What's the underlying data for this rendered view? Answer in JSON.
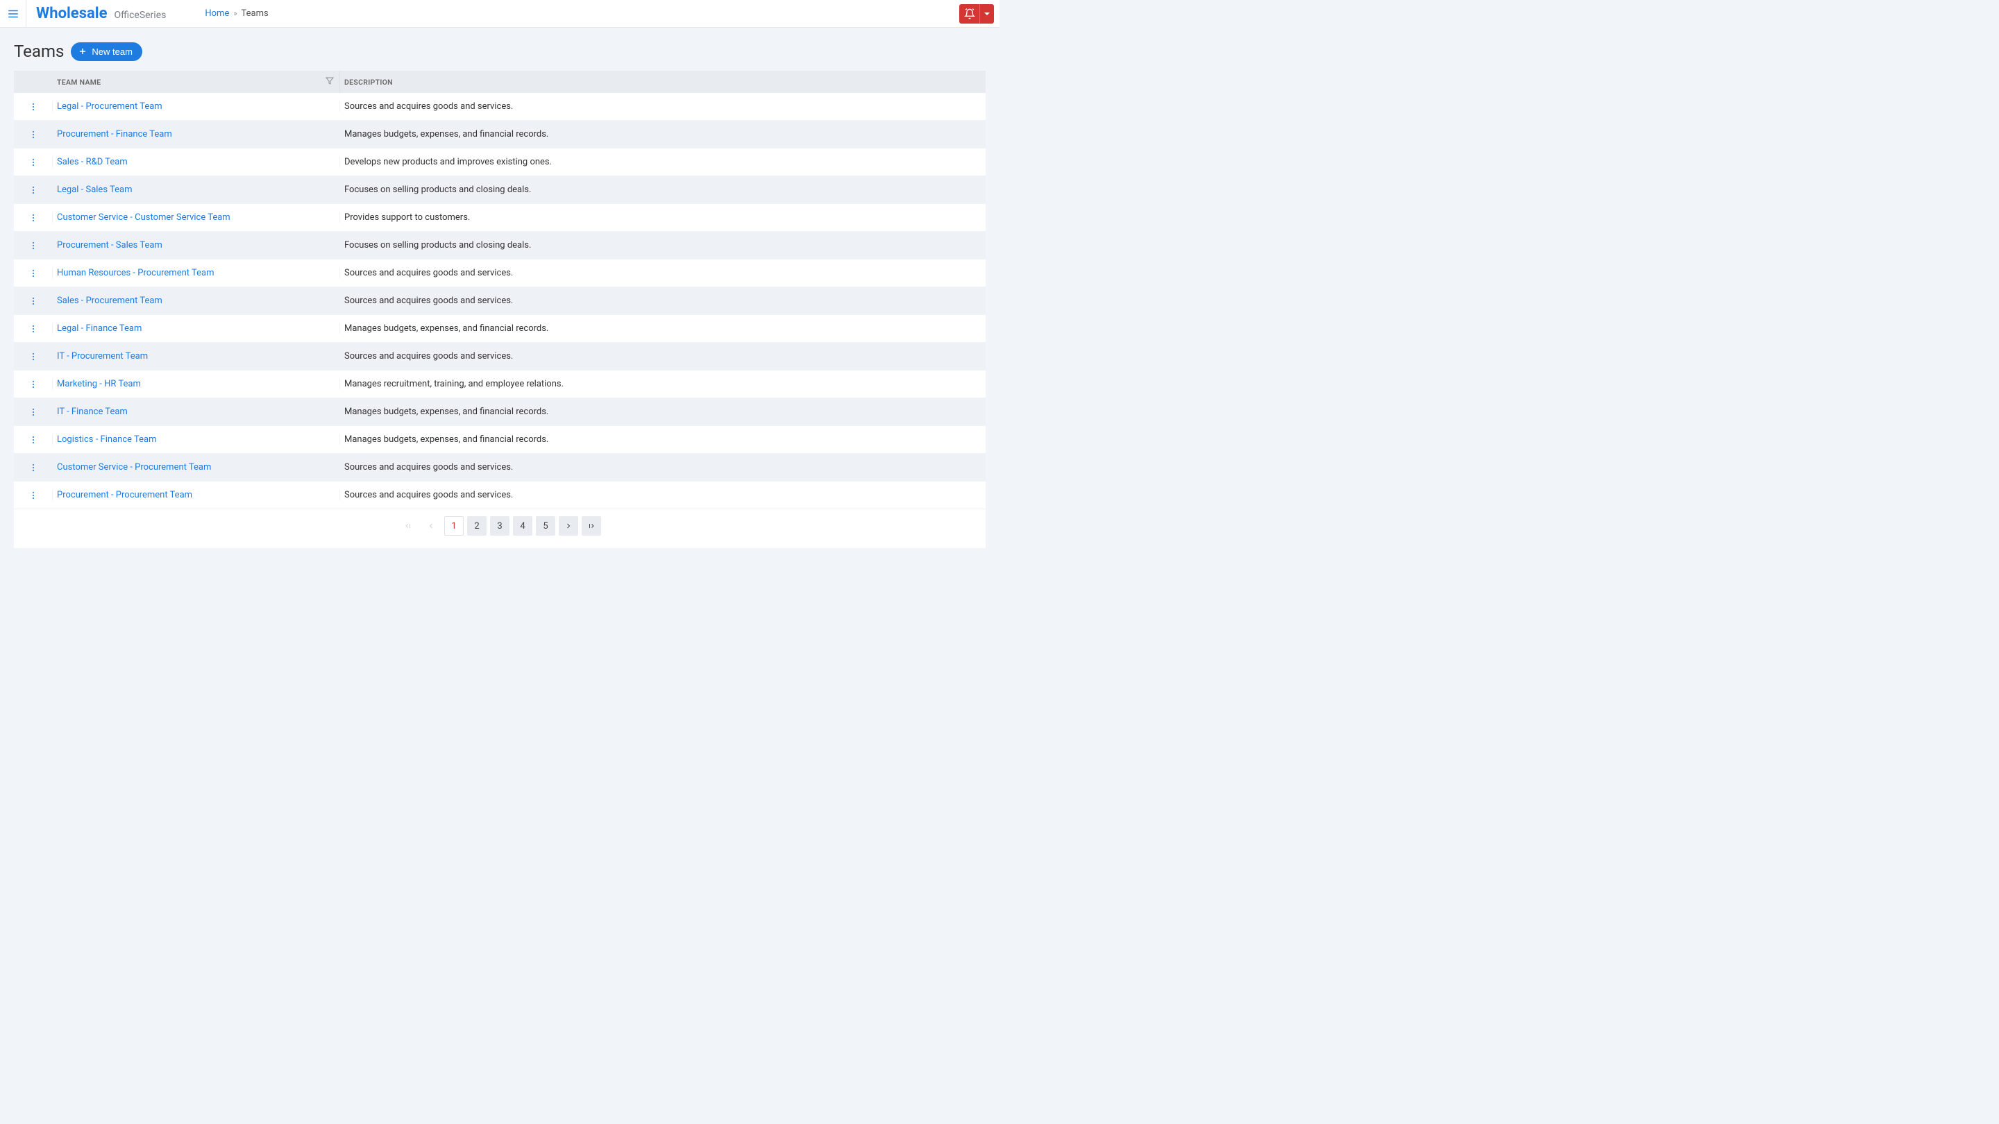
{
  "header": {
    "brand_main": "Wholesale",
    "brand_sub": "OfficeSeries"
  },
  "breadcrumb": {
    "home": "Home",
    "current": "Teams"
  },
  "page": {
    "title": "Teams",
    "new_button": "New team"
  },
  "table": {
    "columns": {
      "name": "TEAM NAME",
      "description": "DESCRIPTION"
    },
    "rows": [
      {
        "name": "Legal - Procurement Team",
        "description": "Sources and acquires goods and services."
      },
      {
        "name": "Procurement - Finance Team",
        "description": "Manages budgets, expenses, and financial records."
      },
      {
        "name": "Sales - R&D Team",
        "description": "Develops new products and improves existing ones."
      },
      {
        "name": "Legal - Sales Team",
        "description": "Focuses on selling products and closing deals."
      },
      {
        "name": "Customer Service - Customer Service Team",
        "description": "Provides support to customers."
      },
      {
        "name": "Procurement - Sales Team",
        "description": "Focuses on selling products and closing deals."
      },
      {
        "name": "Human Resources - Procurement Team",
        "description": "Sources and acquires goods and services."
      },
      {
        "name": "Sales - Procurement Team",
        "description": "Sources and acquires goods and services."
      },
      {
        "name": "Legal - Finance Team",
        "description": "Manages budgets, expenses, and financial records."
      },
      {
        "name": "IT - Procurement Team",
        "description": "Sources and acquires goods and services."
      },
      {
        "name": "Marketing - HR Team",
        "description": "Manages recruitment, training, and employee relations."
      },
      {
        "name": "IT - Finance Team",
        "description": "Manages budgets, expenses, and financial records."
      },
      {
        "name": "Logistics - Finance Team",
        "description": "Manages budgets, expenses, and financial records."
      },
      {
        "name": "Customer Service - Procurement Team",
        "description": "Sources and acquires goods and services."
      },
      {
        "name": "Procurement - Procurement Team",
        "description": "Sources and acquires goods and services."
      }
    ]
  },
  "pagination": {
    "pages": [
      "1",
      "2",
      "3",
      "4",
      "5"
    ],
    "active": "1"
  }
}
